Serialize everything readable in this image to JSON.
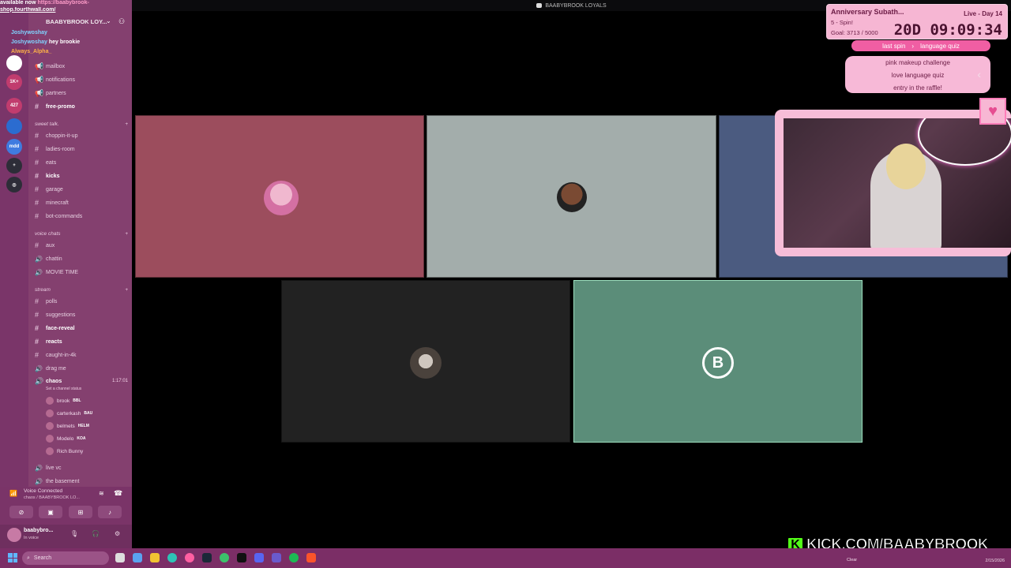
{
  "window": {
    "title": "BAABYBROOK LOYALS"
  },
  "ticker": {
    "line1": "available now",
    "line1_link": "https://baabybrook-",
    "line2": "shop.fourthwall.com/"
  },
  "chat_overlay": [
    {
      "name": "Joshywoshay",
      "color": "#7fd4ff",
      "message": ""
    },
    {
      "name": "Joshywoshay",
      "color": "#7fd4ff",
      "message": "hey brookie"
    },
    {
      "name": "Always_Alpha_",
      "color": "#ffb347",
      "message": ""
    }
  ],
  "server": {
    "name": "BAABYBROOK LOY..."
  },
  "servers": [
    {
      "label": "1K+",
      "color": "#c13c6e"
    },
    {
      "label": "427",
      "color": "#c13c6e"
    },
    {
      "label": "",
      "color": "#2b6cd0"
    },
    {
      "label": "mdd",
      "color": "#3f7be0"
    },
    {
      "label": "+",
      "color": "#2d2d38"
    },
    {
      "label": "◎",
      "color": "#2d2d38"
    }
  ],
  "channels_top": [
    {
      "label": "mailbox",
      "type": "announce"
    },
    {
      "label": "notifications",
      "type": "announce"
    },
    {
      "label": "partners",
      "type": "announce"
    },
    {
      "label": "free-promo",
      "type": "text",
      "unread": true
    }
  ],
  "categories": {
    "sweet_talk": "sweet talk.",
    "voice_chats": "voice chats",
    "stream": "stream"
  },
  "channels_sweet": [
    {
      "label": "choppin-it-up",
      "type": "text"
    },
    {
      "label": "ladies-room",
      "type": "text"
    },
    {
      "label": "eats",
      "type": "text"
    },
    {
      "label": "kicks",
      "type": "text",
      "unread": true
    },
    {
      "label": "garage",
      "type": "text"
    },
    {
      "label": "minecraft",
      "type": "text"
    },
    {
      "label": "bot-commands",
      "type": "text"
    }
  ],
  "channels_voice": [
    {
      "label": "aux",
      "type": "text"
    },
    {
      "label": "chattin",
      "type": "voice"
    },
    {
      "label": "MOVIE TIME",
      "type": "voice"
    }
  ],
  "channels_stream": [
    {
      "label": "polls",
      "type": "text"
    },
    {
      "label": "suggestions",
      "type": "text"
    },
    {
      "label": "face-reveal",
      "type": "text",
      "unread": true
    },
    {
      "label": "reacts",
      "type": "text",
      "unread": true
    },
    {
      "label": "caught-in-4k",
      "type": "text"
    },
    {
      "label": "drag me",
      "type": "voice"
    }
  ],
  "active_vc": {
    "label": "chaos",
    "duration": "1:17:01",
    "status": "Set a channel status",
    "users": [
      {
        "name": "brook",
        "badge": "BBL"
      },
      {
        "name": "carterkash",
        "badge": "BAU"
      },
      {
        "name": "belmets",
        "badge": "HELM"
      },
      {
        "name": "Modelo",
        "badge": "KOA"
      },
      {
        "name": "Rich Bunny",
        "badge": ""
      }
    ]
  },
  "channels_after": [
    {
      "label": "live vc",
      "type": "voice"
    },
    {
      "label": "the basement",
      "type": "voice"
    }
  ],
  "voice_panel": {
    "title": "Voice Connected",
    "subtitle": "chaos / BAABYBROOK LO..."
  },
  "user_panel": {
    "name": "baabybro...",
    "status": "In voice"
  },
  "tiles": [
    {
      "bg": "#9c4d5d"
    },
    {
      "bg": "#a3adab"
    },
    {
      "bg": "#4b5b80"
    },
    {
      "bg": "#222222"
    },
    {
      "bg": "#5b8d79",
      "letter": "B"
    }
  ],
  "subathon": {
    "title": "Anniversary Subath...",
    "live": "Live - Day 14",
    "spin": "5 - Spin!",
    "goal": "Goal: 3713 / 5000",
    "timer": "20D 09:09:34",
    "last_spin_label": "last spin",
    "last_spin_value": "language quiz",
    "wheel": [
      "pink makeup challenge",
      "love language quiz",
      "entry in the raffle!"
    ]
  },
  "kick": {
    "logo": "K",
    "url": "KICK.COM/BAABYBROOK"
  },
  "taskbar": {
    "search_placeholder": "Search",
    "weather": "Clear",
    "date": "2/15/2026"
  },
  "colors": {
    "accent": "#f05ea3",
    "kick_green": "#53fc18",
    "sidebar": "#84406f"
  }
}
